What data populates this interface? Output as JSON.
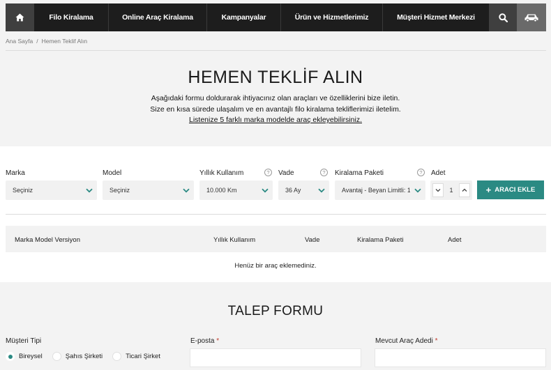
{
  "nav": {
    "home_icon": "home-icon",
    "items": [
      "Filo Kiralama",
      "Online Araç Kiralama",
      "Kampanyalar",
      "Ürün ve Hizmetlerimiz",
      "Müşteri Hizmet Merkezi"
    ],
    "search_icon": "search-icon",
    "car_icon": "car-icon"
  },
  "breadcrumb": {
    "home": "Ana Sayfa",
    "separator": "/",
    "current": "Hemen Teklif Alın"
  },
  "hero": {
    "title": "HEMEN TEKLİF ALIN",
    "line1": "Aşağıdaki formu doldurarak ihtiyacınız olan araçları ve özelliklerini bize iletin.",
    "line2": "Size en kısa sürede ulaşalım ve en avantajlı filo kiralama tekliflerimizi iletelim.",
    "line3": "Listenize 5 farklı marka modelde araç ekleyebilirsiniz."
  },
  "vehicle_form": {
    "brand": {
      "label": "Marka",
      "value": "Seçiniz"
    },
    "model": {
      "label": "Model",
      "value": "Seçiniz"
    },
    "usage": {
      "label": "Yıllık Kullanım",
      "value": "10.000 Km"
    },
    "term": {
      "label": "Vade",
      "value": "36 Ay"
    },
    "package": {
      "label": "Kiralama Paketi",
      "value": "Avantaj - Beyan Limitli: 1"
    },
    "quantity": {
      "label": "Adet",
      "value": "1"
    },
    "help_glyph": "?",
    "add_button": {
      "plus": "+",
      "label": "ARACI EKLE"
    }
  },
  "table": {
    "headers": [
      "Marka Model Versiyon",
      "Yıllık Kullanım",
      "Vade",
      "Kiralama Paketi",
      "Adet"
    ],
    "empty_message": "Henüz bir araç eklemediniz."
  },
  "request_form": {
    "title": "TALEP FORMU",
    "customer_type": {
      "label": "Müşteri Tipi",
      "options": [
        "Bireysel",
        "Şahıs Şirketi",
        "Ticari Şirket"
      ],
      "selected": "Bireysel"
    },
    "email": {
      "label": "E-posta",
      "required_mark": "*"
    },
    "fleet_size": {
      "label": "Mevcut Araç Adedi",
      "required_mark": "*"
    }
  },
  "colors": {
    "accent": "#2b8a83",
    "nav_bg": "#1d1d1d",
    "required": "#c0392b"
  }
}
